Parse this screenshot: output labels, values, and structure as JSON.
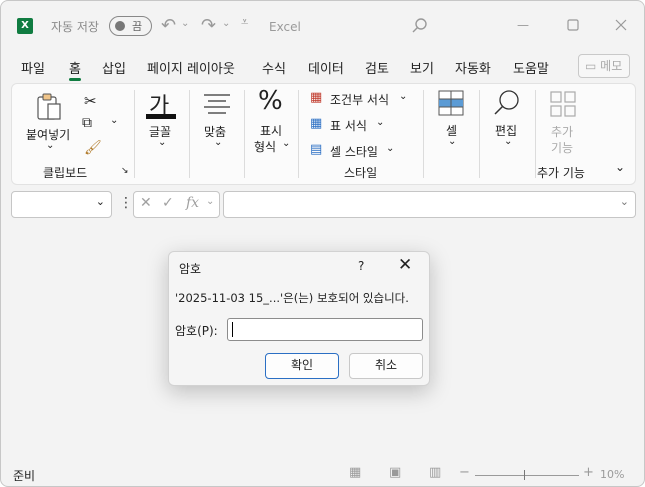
{
  "titlebar": {
    "logo": "X",
    "autosave_label": "자동 저장",
    "autosave_state": "끔",
    "app_name": "Excel",
    "icons": [
      "undo-icon",
      "redo-icon",
      "customize-qat-icon",
      "search-icon",
      "minimize-icon",
      "maximize-icon",
      "close-icon"
    ]
  },
  "menu": {
    "items": [
      "파일",
      "홈",
      "삽입",
      "페이지 레이아웃",
      "수식",
      "데이터",
      "검토",
      "보기",
      "자동화",
      "도움말"
    ],
    "active": "홈",
    "memo": "메모"
  },
  "ribbon": {
    "clipboard": {
      "paste": "붙여넣기",
      "group": "클립보드"
    },
    "font": {
      "glyph": "가",
      "label": "글꼴"
    },
    "align": {
      "label": "맞춤"
    },
    "number": {
      "glyph": "%",
      "label1": "표시",
      "label2": "형식"
    },
    "styles": {
      "cond": "조건부 서식",
      "table": "표 서식",
      "cell": "셀 스타일",
      "group": "스타일"
    },
    "cells": {
      "label": "셀"
    },
    "edit": {
      "label": "편집"
    },
    "addins": {
      "label1": "추가",
      "label2": "기능",
      "group": "추가 기능"
    }
  },
  "formula_bar": {
    "fx": "fx"
  },
  "status": {
    "text": "준비",
    "zoom": "10%"
  },
  "dialog": {
    "title": "암호",
    "help": "?",
    "message": "'2025-11-03 15_...'은(는) 보호되어 있습니다.",
    "password_label": "암호(P):",
    "password_value": "",
    "ok": "확인",
    "cancel": "취소"
  }
}
